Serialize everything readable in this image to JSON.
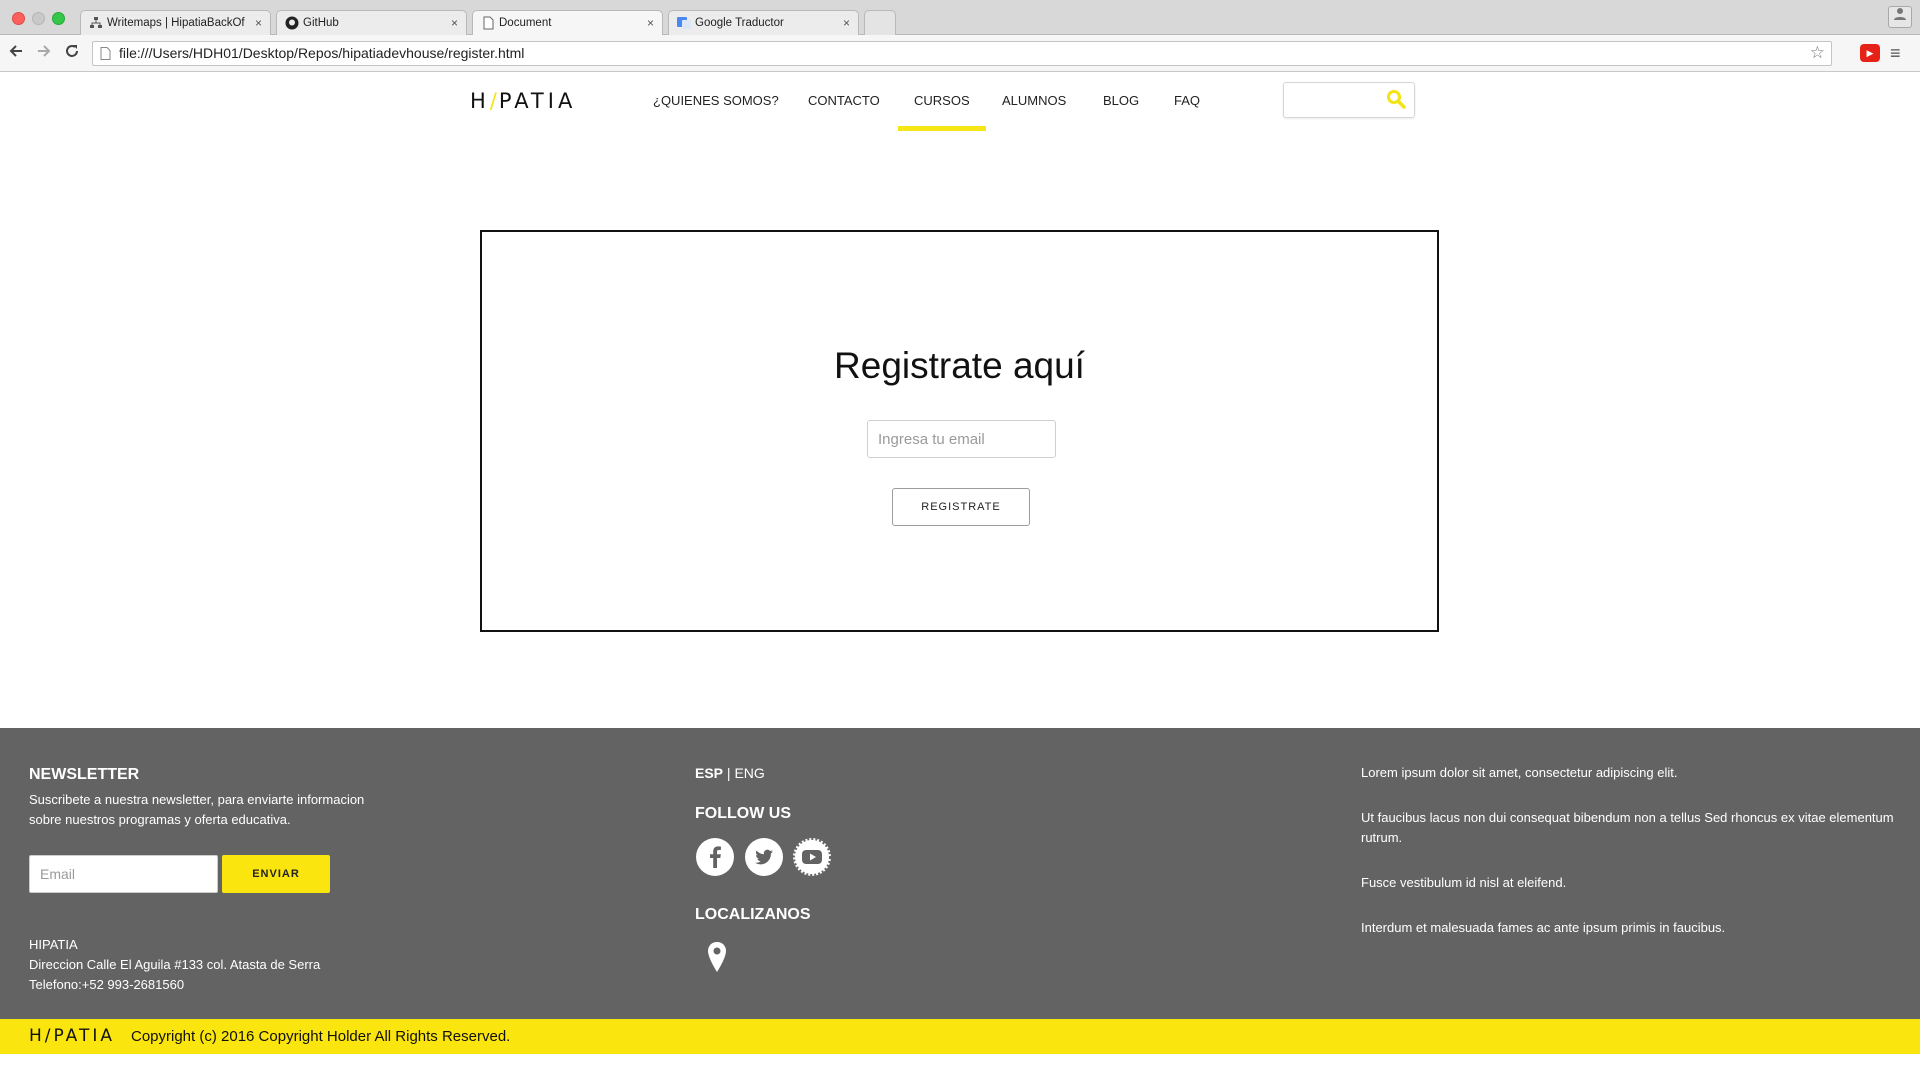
{
  "browser": {
    "tabs": [
      {
        "title": "Writemaps | HipatiaBackOf",
        "icon": "sitemap-icon"
      },
      {
        "title": "GitHub",
        "icon": "github-icon"
      },
      {
        "title": "Document",
        "icon": "document-icon",
        "active": true
      },
      {
        "title": "Google Traductor",
        "icon": "google-translate-icon"
      }
    ],
    "tab_close": "×",
    "url": "file:///Users/HDH01/Desktop/Repos/hipatiadevhouse/register.html"
  },
  "site": {
    "logo": {
      "left": "H",
      "slash": "/",
      "right": "PATIA"
    },
    "nav": [
      {
        "label": "¿QUIENES SOMOS?"
      },
      {
        "label": "CONTACTO"
      },
      {
        "label": "CURSOS",
        "active": true
      },
      {
        "label": "ALUMNOS"
      },
      {
        "label": "BLOG"
      },
      {
        "label": "FAQ"
      }
    ],
    "search": {
      "value": ""
    }
  },
  "register": {
    "title": "Registrate aquí",
    "email_placeholder": "Ingresa tu email",
    "button_label": "REGISTRATE"
  },
  "footer": {
    "newsletter": {
      "heading": "NEWSLETTER",
      "text_line1": "Suscribete a nuestra newsletter, para enviarte informacion",
      "text_line2": "sobre nuestros programas y oferta educativa.",
      "email_placeholder": "Email",
      "button_label": "ENVIAR"
    },
    "contact": {
      "name": "HIPATIA",
      "address": "Direccion Calle El Aguila #133 col. Atasta de Serra",
      "phone": "Telefono:+52 993-2681560"
    },
    "language": {
      "esp": "ESP",
      "separator": " | ",
      "eng": "ENG"
    },
    "follow_heading": "FOLLOW US",
    "social": [
      "facebook-icon",
      "twitter-icon",
      "youtube-icon"
    ],
    "locate_heading": "LOCALIZANOS",
    "lorem": [
      "Lorem ipsum dolor sit amet, consectetur adipiscing elit.",
      "Ut faucibus lacus non dui consequat bibendum non a tellus Sed rhoncus ex vitae elementum",
      "rutrum.",
      "Fusce vestibulum id nisl at eleifend.",
      "Interdum et malesuada fames ac ante ipsum primis in faucibus."
    ],
    "bottom_logo": "H/PATIA",
    "copyright": "Copyright (c) 2016 Copyright Holder All Rights Reserved."
  },
  "colors": {
    "accent": "#fbe50f",
    "footer_bg": "#636363"
  }
}
